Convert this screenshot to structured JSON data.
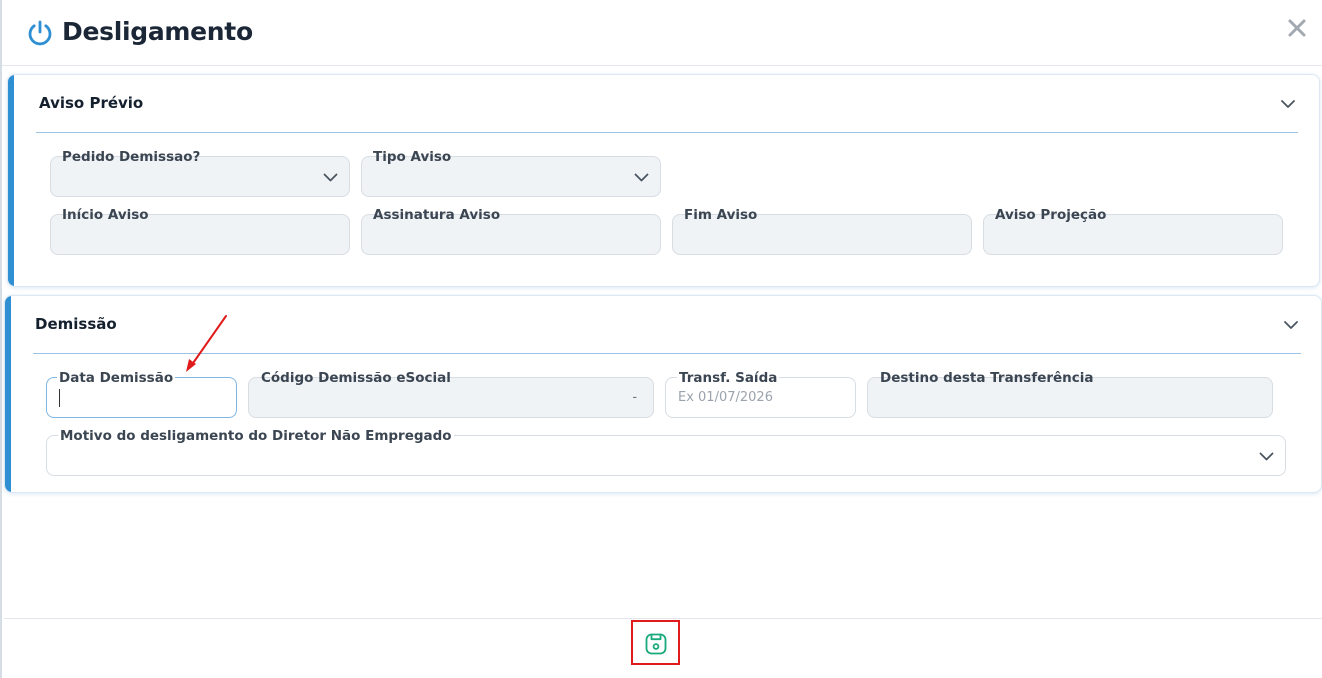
{
  "dialog": {
    "title": "Desligamento",
    "icons": {
      "title": "power-icon",
      "close": "close-icon",
      "save": "save-icon"
    }
  },
  "aviso_previo": {
    "title": "Aviso Prévio",
    "fields": {
      "pedido_demissao": {
        "label": "Pedido Demissao?",
        "value": ""
      },
      "tipo_aviso": {
        "label": "Tipo Aviso",
        "value": ""
      },
      "inicio_aviso": {
        "label": "Início Aviso",
        "value": ""
      },
      "assinatura_aviso": {
        "label": "Assinatura Aviso",
        "value": ""
      },
      "fim_aviso": {
        "label": "Fim Aviso",
        "value": ""
      },
      "aviso_projecao": {
        "label": "Aviso Projeção",
        "value": ""
      }
    }
  },
  "demissao": {
    "title": "Demissão",
    "fields": {
      "data_demissao": {
        "label": "Data Demissão",
        "value": ""
      },
      "codigo_esocial": {
        "label": "Código Demissão eSocial",
        "value": "-"
      },
      "transf_saida": {
        "label": "Transf. Saída",
        "placeholder": "Ex 01/07/2026"
      },
      "destino_transferencia": {
        "label": "Destino desta Transferência",
        "value": ""
      },
      "motivo_desligamento": {
        "label": "Motivo do desligamento do Diretor Não Empregado",
        "value": ""
      }
    }
  },
  "colors": {
    "accent": "#2e8fd3",
    "save_icon": "#1aa97a",
    "highlight": "#e01b1b"
  }
}
